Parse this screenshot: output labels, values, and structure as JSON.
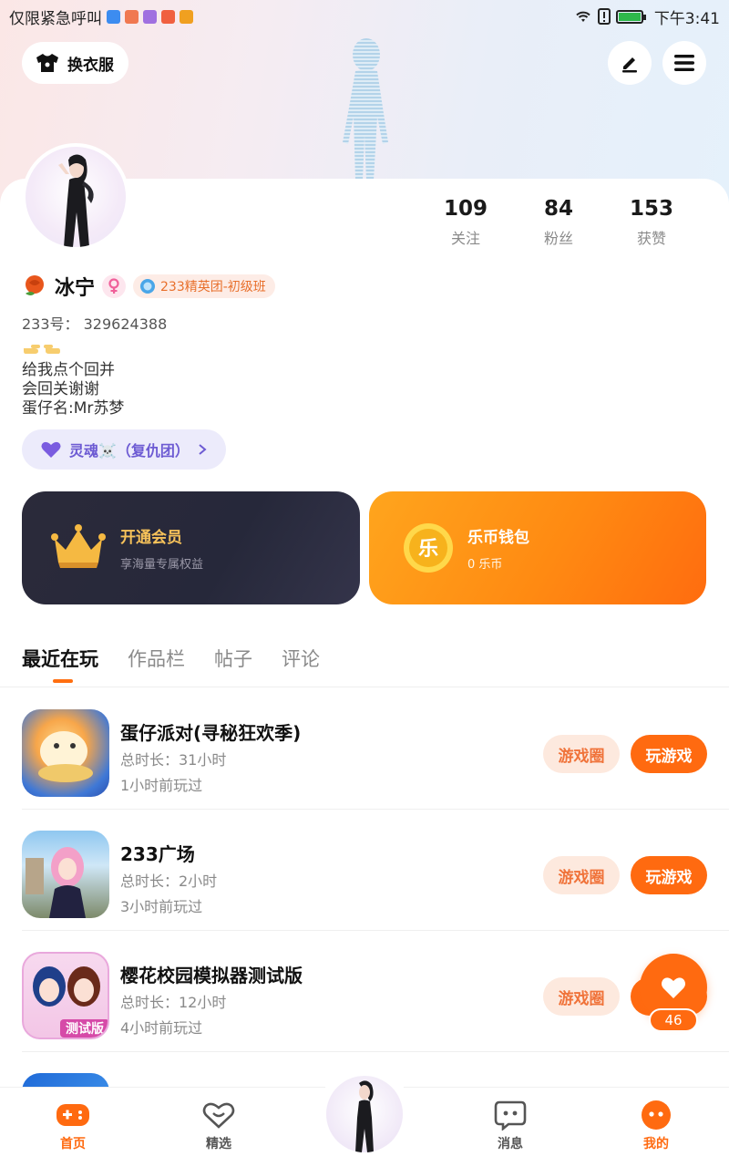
{
  "status_bar": {
    "left_text": "仅限紧急呼叫",
    "time": "下午3:41",
    "notif_colors": [
      "#3c8cf0",
      "#f07850",
      "#a070e0",
      "#f06040",
      "#f0a020"
    ]
  },
  "header": {
    "outfit_label": "换衣服",
    "edit_icon": "pen-icon",
    "menu_icon": "hamburger-icon"
  },
  "stats": [
    {
      "num": "109",
      "label": "关注"
    },
    {
      "num": "84",
      "label": "粉丝"
    },
    {
      "num": "153",
      "label": "获赞"
    }
  ],
  "profile": {
    "name": "冰宁",
    "rank": "233精英团-初级班",
    "uid": "233号：  329624388",
    "bio_lines": [
      "给我点个回并",
      "会回关谢谢",
      "蛋仔名:Mr苏梦"
    ],
    "group": "灵魂☠️（复仇团）"
  },
  "cards": {
    "vip_title": "开通会员",
    "vip_sub": "享海量专属权益",
    "coin_title": "乐币钱包",
    "coin_sub": "0 乐币",
    "coin_glyph": "乐"
  },
  "tabs": [
    "最近在玩",
    "作品栏",
    "帖子",
    "评论"
  ],
  "games": [
    {
      "name": "蛋仔派对(寻秘狂欢季)",
      "time": "总时长：31小时",
      "last": "1小时前玩过"
    },
    {
      "name": "233广场",
      "time": "总时长：2小时",
      "last": "3小时前玩过"
    },
    {
      "name": "樱花校园模拟器测试版",
      "time": "总时长：12小时",
      "last": "4小时前玩过"
    }
  ],
  "game_buttons": {
    "circle": "游戏圈",
    "play": "玩游戏"
  },
  "test_tag": "测试版",
  "like": {
    "count": "46"
  },
  "nav": [
    {
      "label": "首页"
    },
    {
      "label": "精选"
    },
    {
      "label": "消息"
    },
    {
      "label": "我的"
    }
  ],
  "colors": {
    "accent": "#ff6a10",
    "vip_bg": "#2b2a3a",
    "coin_bg": "#ff8a12"
  }
}
